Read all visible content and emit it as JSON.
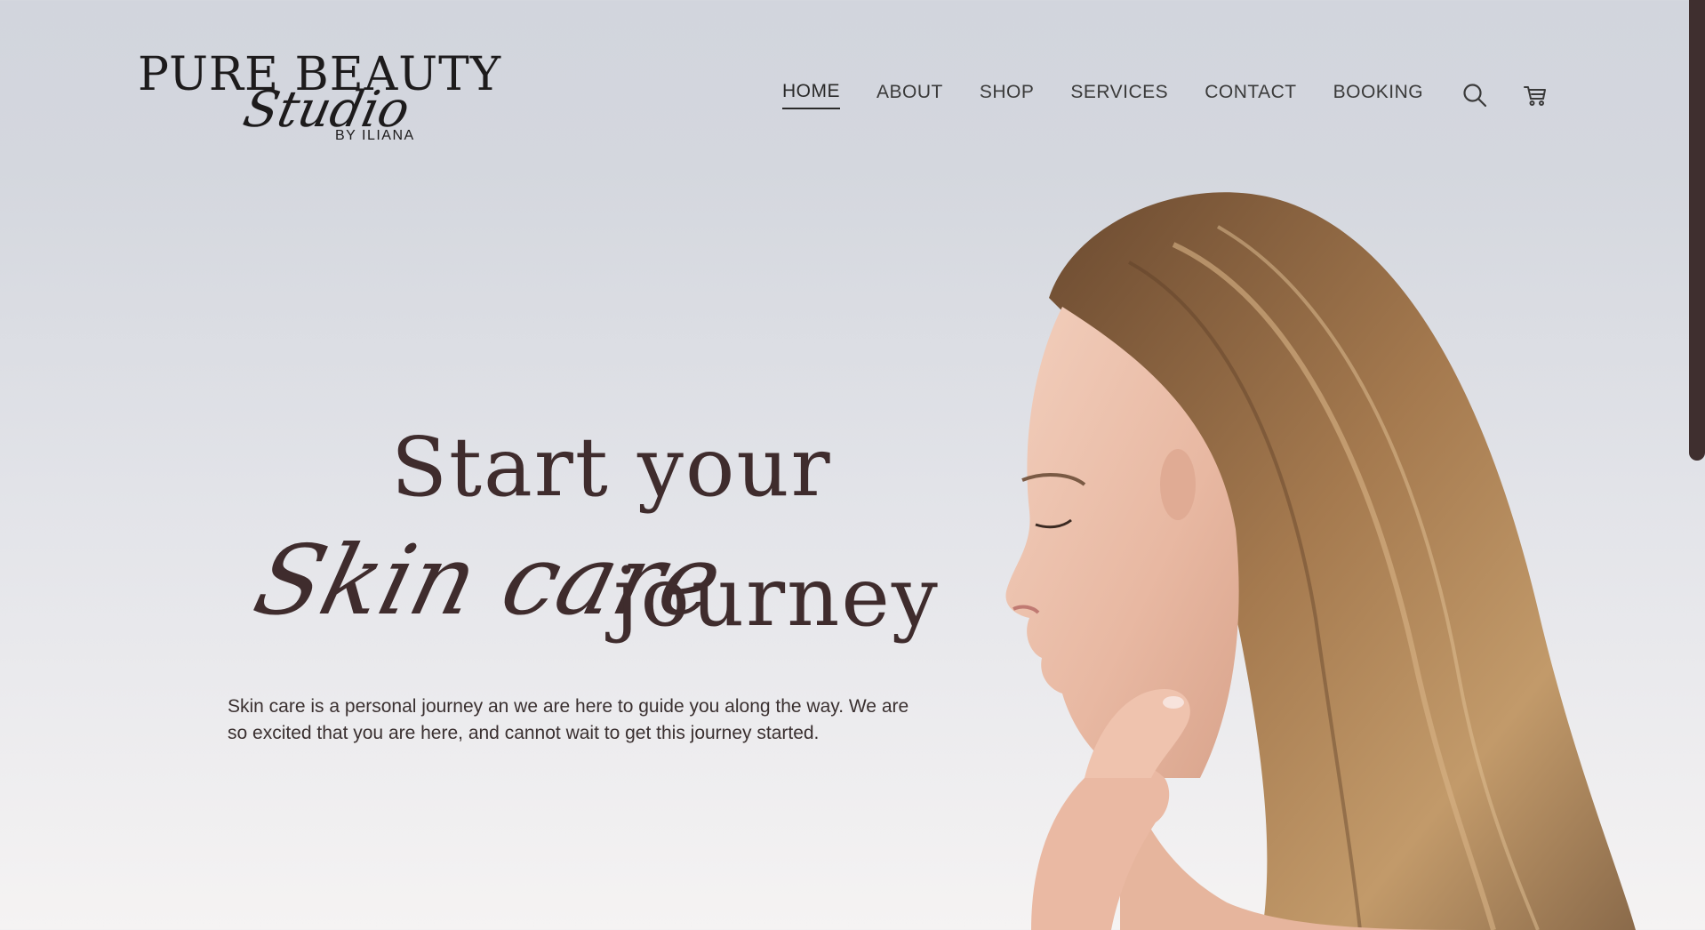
{
  "brand": {
    "name_main": "PURE BEAUTY",
    "name_script": "Studio",
    "byline": "BY ILIANA"
  },
  "nav": {
    "items": [
      {
        "label": "HOME",
        "active": true
      },
      {
        "label": "ABOUT",
        "active": false
      },
      {
        "label": "SHOP",
        "active": false
      },
      {
        "label": "SERVICES",
        "active": false
      },
      {
        "label": "CONTACT",
        "active": false
      },
      {
        "label": "BOOKING",
        "active": false
      }
    ],
    "icons": [
      "search-icon",
      "cart-icon"
    ]
  },
  "hero": {
    "line1": "Start your",
    "line2_script": "Skin care",
    "line2_plain": "journey",
    "description": "Skin care is a personal journey an we are here to guide you along the way. We are so excited that you are here, and cannot wait to get this journey started."
  },
  "colors": {
    "accent": "#3f2c2d",
    "background_top": "#d2d5dd",
    "background_bottom": "#f5f3f3",
    "scrollbar": "#3f2f2f"
  }
}
